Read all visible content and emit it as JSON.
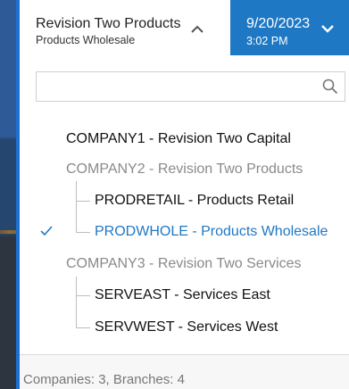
{
  "header": {
    "company_name": "Revision Two Products",
    "branch_name": "Products Wholesale",
    "date": "9/20/2023",
    "time": "3:02 PM"
  },
  "search": {
    "value": "",
    "placeholder": ""
  },
  "tree": {
    "companies": [
      {
        "label": "COMPANY1 - Revision Two Capital",
        "muted": false,
        "branches": []
      },
      {
        "label": "COMPANY2 - Revision Two Products",
        "muted": true,
        "branches": [
          {
            "label": "PRODRETAIL - Products Retail",
            "selected": false
          },
          {
            "label": "PRODWHOLE - Products Wholesale",
            "selected": true
          }
        ]
      },
      {
        "label": "COMPANY3 - Revision Two Services",
        "muted": true,
        "branches": [
          {
            "label": "SERVEAST - Services East",
            "selected": false
          },
          {
            "label": "SERVWEST - Services West",
            "selected": false
          }
        ]
      }
    ]
  },
  "footer": {
    "summary": "Companies: 3, Branches: 4"
  },
  "colors": {
    "accent": "#1f78c4",
    "muted_text": "#8a8a8a"
  },
  "icons": {
    "company_toggle": "chevron-up-icon",
    "date_toggle": "chevron-down-icon",
    "search": "search-icon",
    "selected_marker": "checkmark-icon"
  }
}
